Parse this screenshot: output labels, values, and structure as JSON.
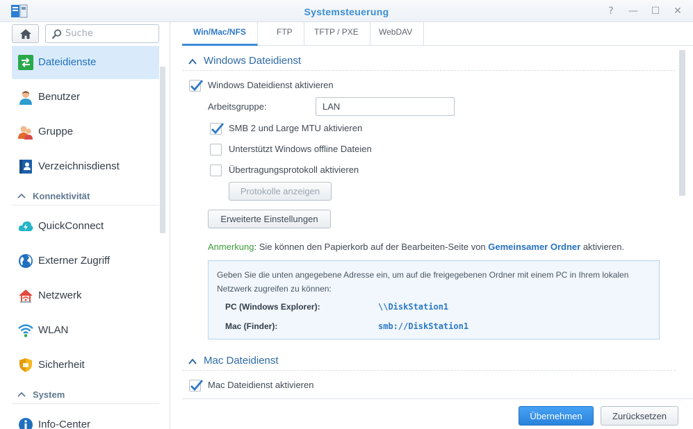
{
  "window": {
    "title": "Systemsteuerung",
    "controls": {
      "help": "?",
      "minimize": "—",
      "maximize": "☐",
      "close": "✕"
    }
  },
  "sidebar": {
    "search_placeholder": "Suche",
    "items_top": [
      {
        "label": "Dateidienste",
        "icon": "file-services-icon",
        "active": true
      },
      {
        "label": "Benutzer",
        "icon": "user-icon"
      },
      {
        "label": "Gruppe",
        "icon": "group-icon"
      },
      {
        "label": "Verzeichnisdienst",
        "icon": "directory-icon"
      }
    ],
    "section_connectivity": "Konnektivität",
    "items_connectivity": [
      {
        "label": "QuickConnect",
        "icon": "quickconnect-icon"
      },
      {
        "label": "Externer Zugriff",
        "icon": "globe-icon"
      },
      {
        "label": "Netzwerk",
        "icon": "network-house-icon"
      },
      {
        "label": "WLAN",
        "icon": "wifi-icon"
      },
      {
        "label": "Sicherheit",
        "icon": "shield-icon"
      }
    ],
    "section_system": "System",
    "items_system": [
      {
        "label": "Info-Center",
        "icon": "info-icon"
      }
    ]
  },
  "tabs": [
    {
      "label": "Win/Mac/NFS",
      "active": true
    },
    {
      "label": "FTP"
    },
    {
      "label": "TFTP / PXE"
    },
    {
      "label": "WebDAV"
    }
  ],
  "windows_service": {
    "title": "Windows Dateidienst",
    "enable_label": "Windows Dateidienst aktivieren",
    "enable_checked": true,
    "workgroup_label": "Arbeitsgruppe:",
    "workgroup_value": "LAN",
    "smb2_label": "SMB 2 und Large MTU aktivieren",
    "smb2_checked": true,
    "offline_label": "Unterstützt Windows offline Dateien",
    "offline_checked": false,
    "protocol_label": "Übertragungsprotokoll aktivieren",
    "protocol_checked": false,
    "show_protocols_button": "Protokolle anzeigen",
    "advanced_button": "Erweiterte Einstellungen",
    "note_prefix": "Anmerkung",
    "note_text": ": Sie können den Papierkorb auf der Bearbeiten-Seite von ",
    "note_link": "Gemeinsamer Ordner",
    "note_suffix": " aktivieren.",
    "info_desc": "Geben Sie die unten angegebene Adresse ein, um auf die freigegebenen Ordner mit einem PC in Ihrem lokalen Netzwerk zugreifen zu können:",
    "pc_label": "PC (Windows Explorer):",
    "pc_value": "\\\\DiskStation1",
    "mac_label": "Mac (Finder):",
    "mac_value": "smb://DiskStation1"
  },
  "mac_service": {
    "title": "Mac Dateidienst",
    "enable_label": "Mac Dateidienst aktivieren",
    "enable_checked": true
  },
  "footer": {
    "apply_button": "Übernehmen",
    "reset_button": "Zurücksetzen"
  },
  "colors": {
    "accent": "#2f7ac6",
    "active_bg": "#d9ebfb",
    "primary_button": "#2a83dc",
    "note_green": "#3a9e3a"
  }
}
